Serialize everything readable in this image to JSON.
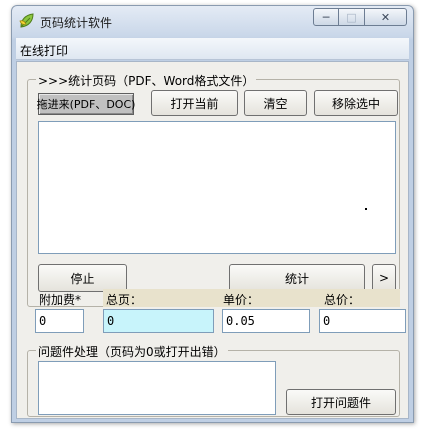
{
  "window": {
    "title": "页码统计软件",
    "min_glyph": "─",
    "max_glyph": "□",
    "close_glyph": "✕"
  },
  "menu": {
    "items": [
      {
        "label": "在线打印"
      }
    ]
  },
  "stats_group": {
    "legend": ">>>统计页码（PDF、Word格式文件）",
    "drop_button": "拖进来(PDF、DOC)",
    "open_current_button": "打开当前",
    "clear_button": "清空",
    "remove_selected_button": "移除选中",
    "stop_button": "停止",
    "count_button": "统计",
    "next_button": ">",
    "file_list": []
  },
  "fields": {
    "surcharge": {
      "label": "附加费*",
      "value": "0"
    },
    "total_pages": {
      "label": "总页：",
      "value": "0"
    },
    "unit_price": {
      "label": "单价：",
      "value": "0.05"
    },
    "total_price": {
      "label": "总价：",
      "value": "0"
    }
  },
  "problem_group": {
    "legend": "问题件处理（页码为0或打开出错）",
    "open_problem_button": "打开问题件",
    "file_list": []
  },
  "colors": {
    "title_bar": "#c9d7e9",
    "client_bg": "#f0efeb",
    "highlight_field": "#c8f4fb",
    "label_strip": "#e8e2cc"
  },
  "icons": [
    "app-leaf-icon",
    "minimize-icon",
    "maximize-icon",
    "close-icon"
  ]
}
